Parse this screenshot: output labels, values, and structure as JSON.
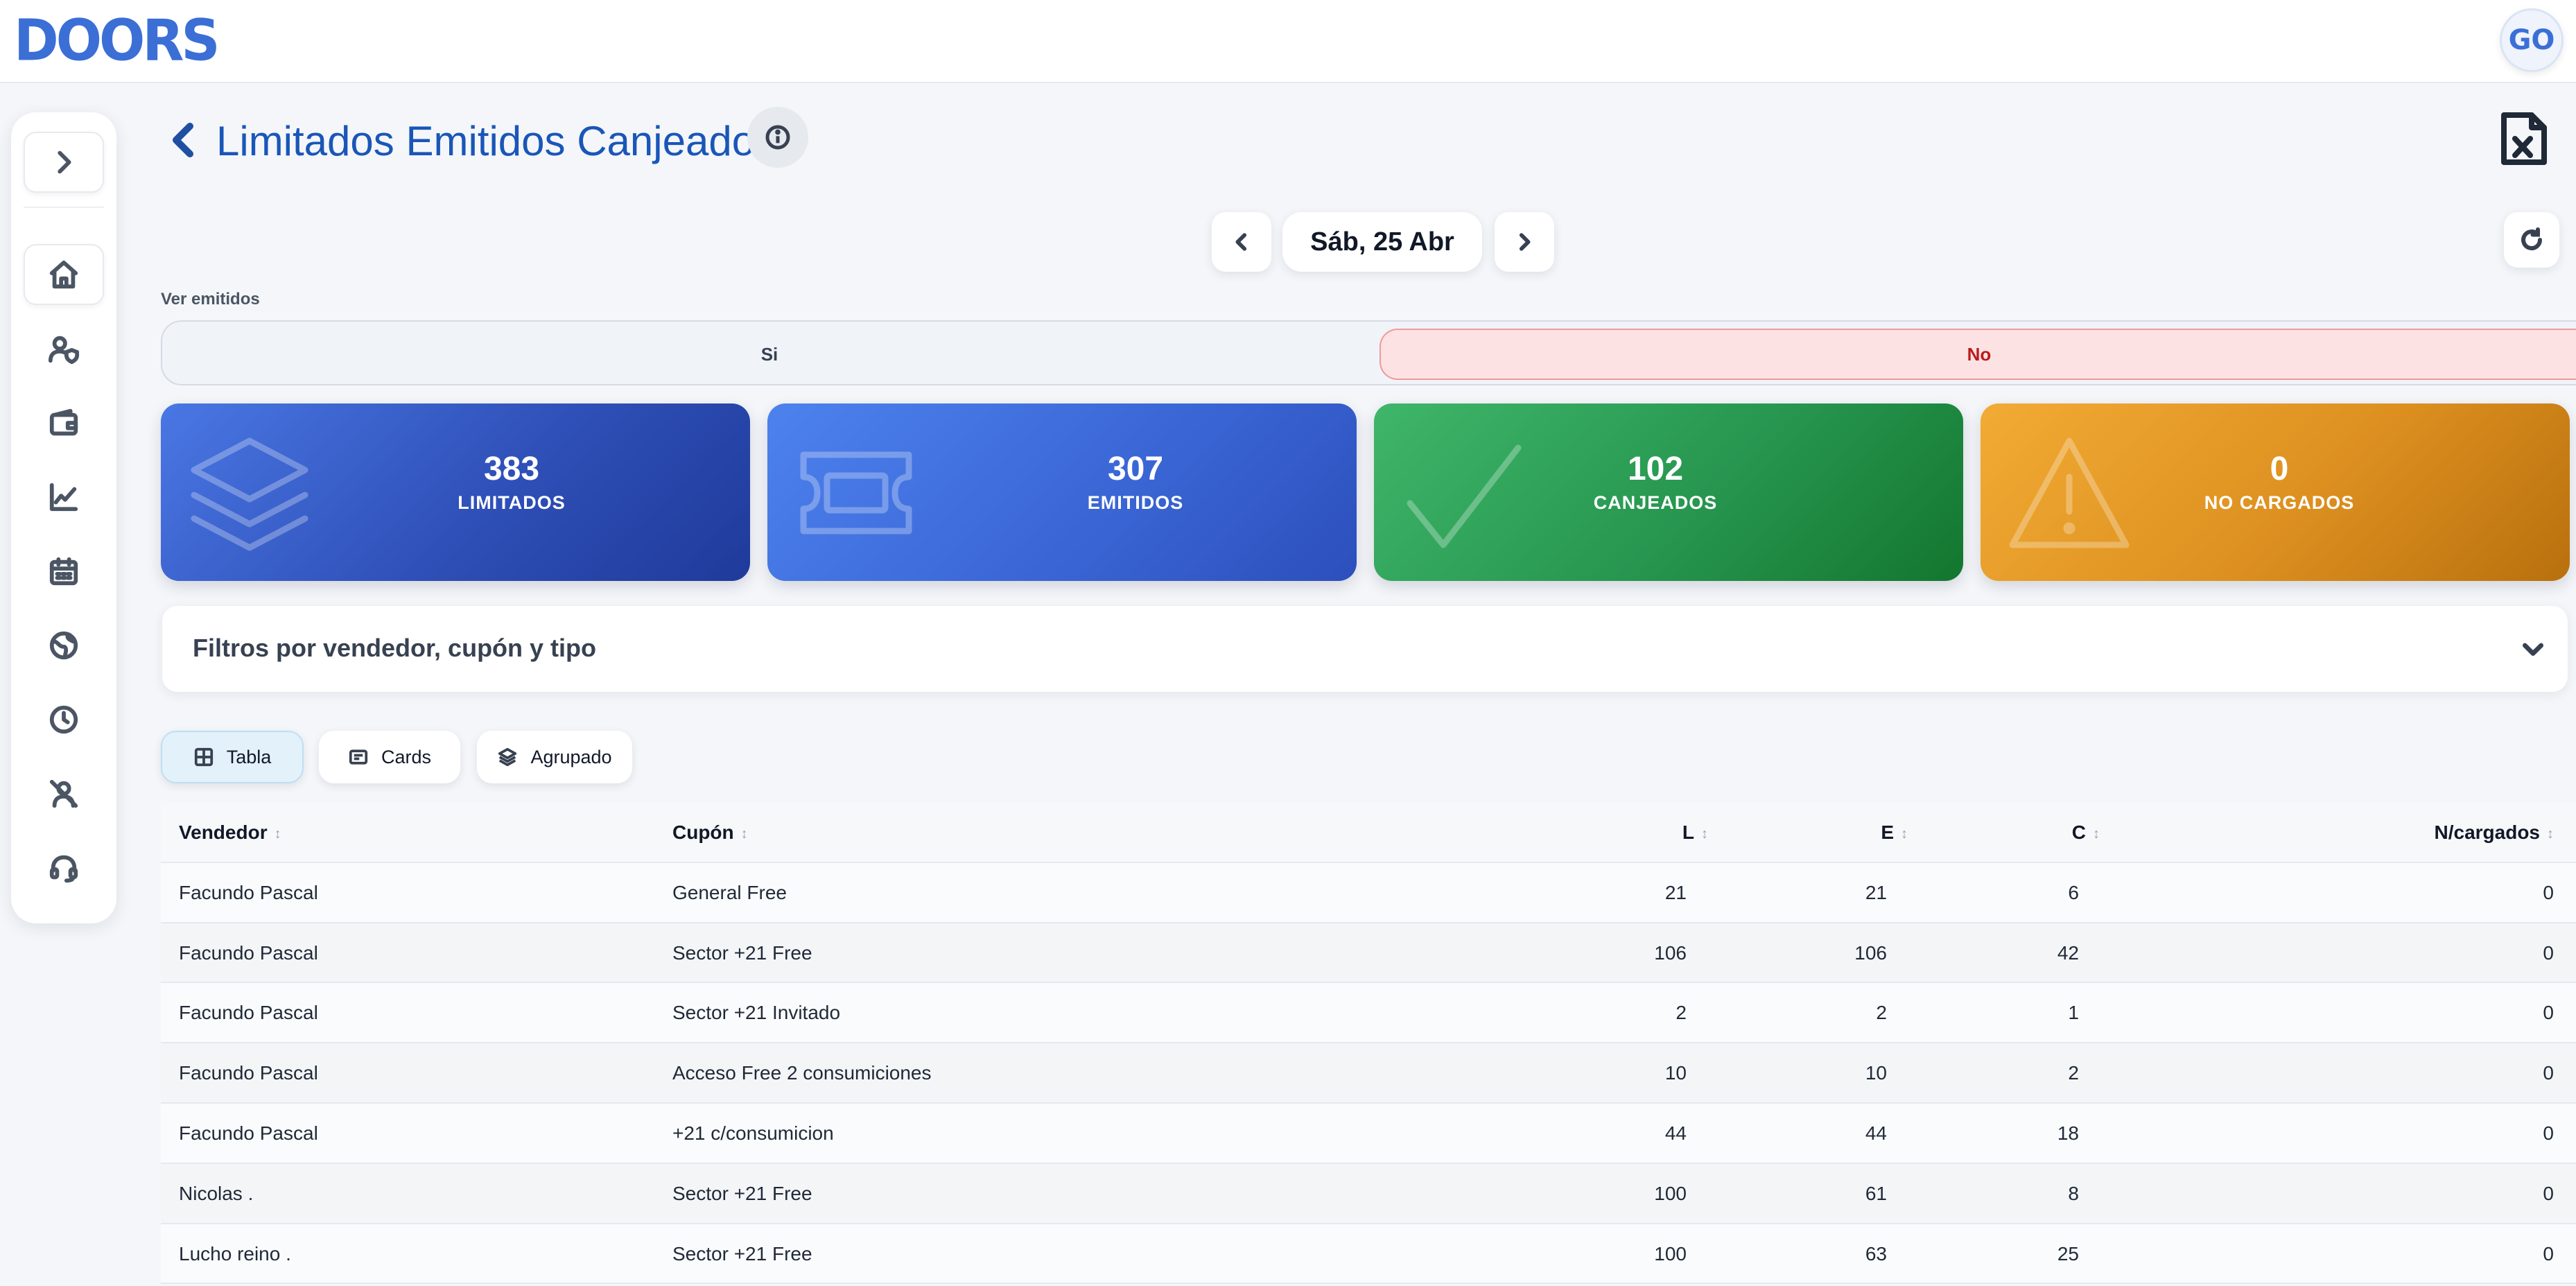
{
  "header": {
    "logo_text": "DOORS",
    "avatar_initials": "GO"
  },
  "sidebar": {
    "toggle_icon": "chevron-right-icon",
    "items": [
      {
        "icon": "home-icon",
        "active": true
      },
      {
        "icon": "user-shield-icon",
        "active": false
      },
      {
        "icon": "wallet-icon",
        "active": false
      },
      {
        "icon": "line-chart-icon",
        "active": false
      },
      {
        "icon": "calendar-icon",
        "active": false
      },
      {
        "icon": "globe-icon",
        "active": false
      },
      {
        "icon": "clock-icon",
        "active": false
      },
      {
        "icon": "user-off-icon",
        "active": false
      },
      {
        "icon": "headset-icon",
        "active": false
      }
    ]
  },
  "page": {
    "title": "Limitados Emitidos Canjeados"
  },
  "date_nav": {
    "label": "Sáb, 25 Abr"
  },
  "ver_emitidos": {
    "label": "Ver emitidos",
    "option_si": "Si",
    "option_no": "No",
    "selected": "No"
  },
  "stats": [
    {
      "value": "383",
      "label": "LIMITADOS",
      "icon": "layers-icon",
      "color": "#2f50b8"
    },
    {
      "value": "307",
      "label": "EMITIDOS",
      "icon": "ticket-icon",
      "color": "#3b67d6"
    },
    {
      "value": "102",
      "label": "CANJEADOS",
      "icon": "check-icon",
      "color": "#27964f"
    },
    {
      "value": "0",
      "label": "NO CARGADOS",
      "icon": "warning-icon",
      "color": "#dd9020"
    }
  ],
  "filters": {
    "title": "Filtros por vendedor, cupón y tipo"
  },
  "view_tabs": [
    {
      "label": "Tabla",
      "icon": "table-icon",
      "active": true
    },
    {
      "label": "Cards",
      "icon": "card-icon",
      "active": false
    },
    {
      "label": "Agrupado",
      "icon": "layers-icon",
      "active": false
    }
  ],
  "table": {
    "columns": [
      "Vendedor",
      "Cupón",
      "L",
      "E",
      "C",
      "N/cargados"
    ],
    "rows": [
      [
        "Facundo Pascal",
        "General Free",
        "21",
        "21",
        "6",
        "0"
      ],
      [
        "Facundo Pascal",
        "Sector +21 Free",
        "106",
        "106",
        "42",
        "0"
      ],
      [
        "Facundo Pascal",
        "Sector +21 Invitado",
        "2",
        "2",
        "1",
        "0"
      ],
      [
        "Facundo Pascal",
        "Acceso Free 2 consumiciones",
        "10",
        "10",
        "2",
        "0"
      ],
      [
        "Facundo Pascal",
        "+21 c/consumicion",
        "44",
        "44",
        "18",
        "0"
      ],
      [
        "Nicolas .",
        "Sector +21 Free",
        "100",
        "61",
        "8",
        "0"
      ],
      [
        "Lucho reino .",
        "Sector +21 Free",
        "100",
        "63",
        "25",
        "0"
      ]
    ]
  }
}
